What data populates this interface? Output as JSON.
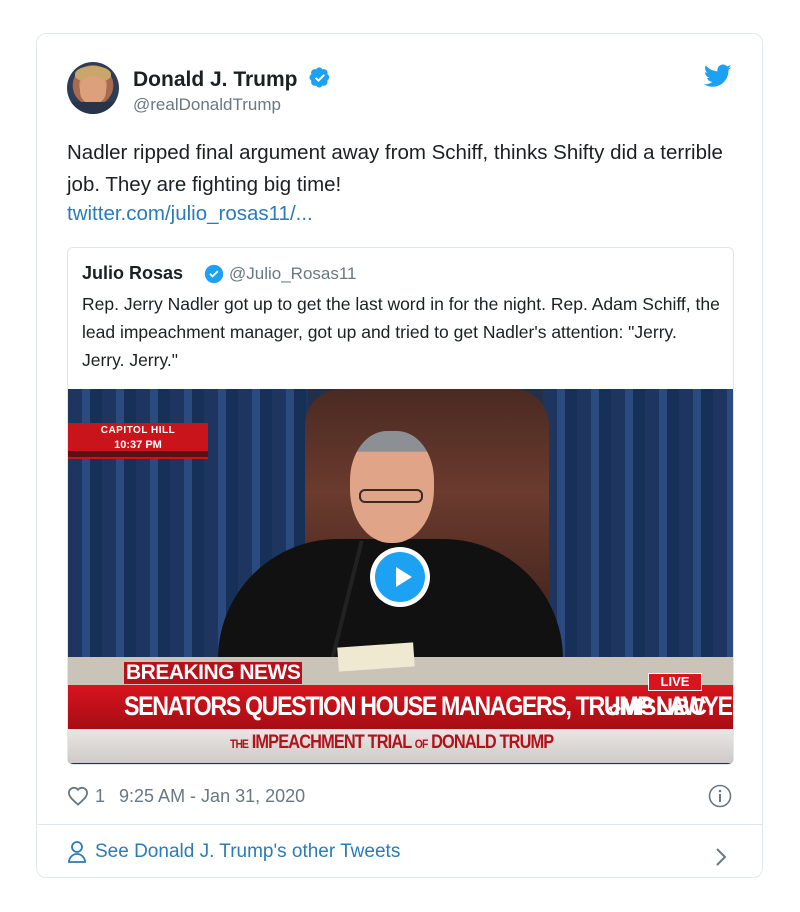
{
  "author": {
    "name": "Donald J. Trump",
    "handle": "@realDonaldTrump"
  },
  "tweet": {
    "text": "Nadler ripped final argument away from Schiff, thinks Shifty did a terrible job. They are fighting big time!",
    "link": "twitter.com/julio_rosas11/..."
  },
  "quoted": {
    "name": "Julio Rosas",
    "handle": "@Julio_Rosas11",
    "text": "Rep. Jerry Nadler got up to get the last word in for the night. Rep. Adam Schiff, the lead impeachment manager, got up and tried to get Nadler's attention: \"Jerry. Jerry. Jerry.\""
  },
  "video": {
    "location": "CAPITOL HILL",
    "time": "10:37 PM",
    "breaking_label": "BREAKING NEWS",
    "headline": "SENATORS QUESTION HOUSE MANAGERS, TRUMP LAWYERS",
    "live_label": "LIVE",
    "network": "MSNBC",
    "lower_the": "THE",
    "lower_main": "IMPEACHMENT TRIAL",
    "lower_of": "OF",
    "lower_name": "DONALD TRUMP"
  },
  "meta": {
    "likes": "1",
    "timestamp": "9:25 AM - Jan 31, 2020"
  },
  "footer": {
    "label": "See Donald J. Trump's other Tweets"
  },
  "colors": {
    "link": "#2b7bb9",
    "verified": "#1da1f2",
    "breaking_red": "#d8141e"
  },
  "icons": [
    "twitter-bird-icon",
    "verified-icon",
    "play-icon",
    "heart-icon",
    "info-icon",
    "person-icon",
    "chevron-right-icon"
  ]
}
